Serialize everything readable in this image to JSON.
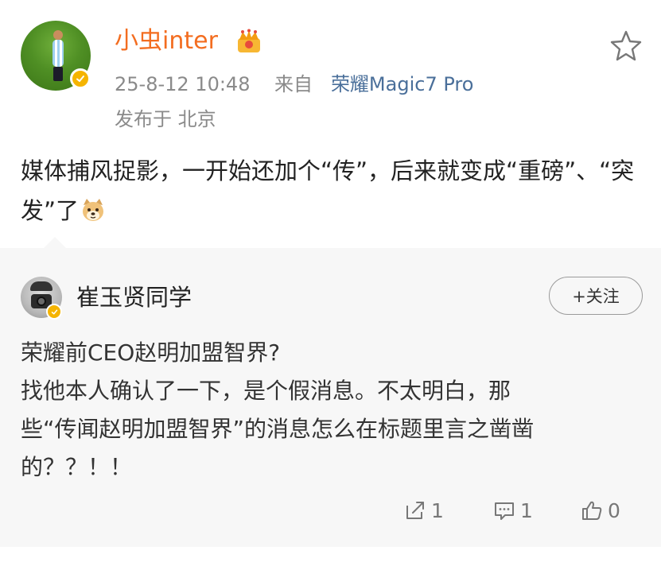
{
  "post": {
    "username": "小虫inter",
    "time": "25-8-12 10:48",
    "source_prefix": "来自",
    "device": "荣耀Magic7 Pro",
    "location": "发布于 北京",
    "content": "媒体捕风捉影，一开始还加个“传”，后来就变成“重磅”、“突发”了",
    "icons": {
      "crown": "crown-icon",
      "favorite": "star-icon",
      "verified": "verified-badge-icon",
      "emoji": "doge-icon"
    }
  },
  "repost": {
    "username": "崔玉贤同学",
    "follow_label": "+关注",
    "lines": [
      "荣耀前CEO赵明加盟智界?",
      "找他本人确认了一下，是个假消息。不太明白，那",
      "些“传闻赵明加盟智界”的消息怎么在标题里言之凿凿",
      "的？？！！"
    ],
    "actions": {
      "repost_count": "1",
      "comment_count": "1",
      "like_count": "0"
    }
  },
  "colors": {
    "username": "#f36d20",
    "device_link": "#4a6f9a",
    "meta_gray": "#8a8a8a",
    "repost_bg": "#f7f7f7",
    "verified": "#f5b400"
  }
}
